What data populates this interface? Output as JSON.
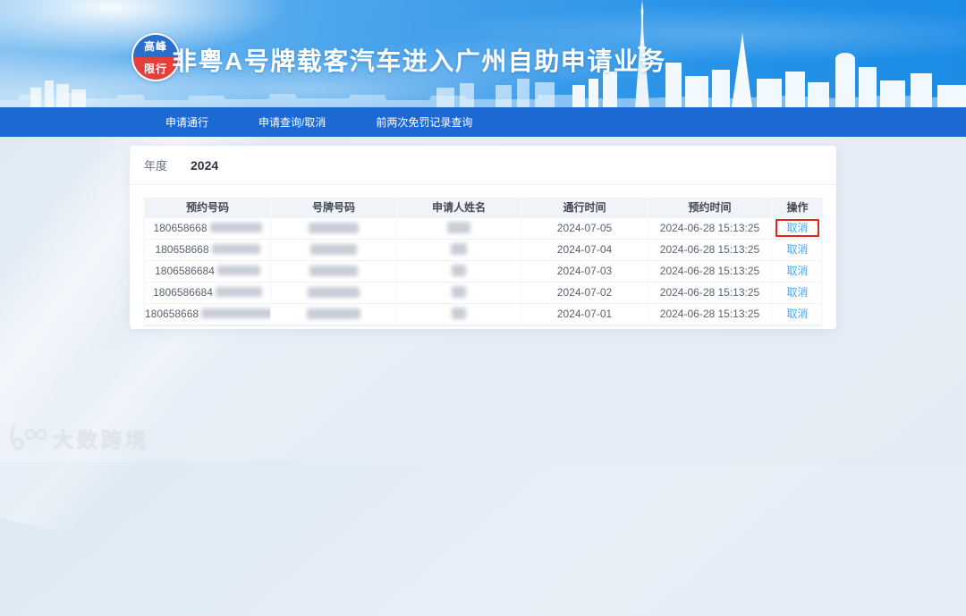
{
  "header": {
    "badge_top": "高峰",
    "badge_bottom": "限行",
    "title": "非粤A号牌载客汽车进入广州自助申请业务"
  },
  "nav": {
    "items": [
      {
        "label": "申请通行"
      },
      {
        "label": "申请查询/取消"
      },
      {
        "label": "前两次免罚记录查询"
      }
    ]
  },
  "filters": {
    "year_label": "年度",
    "year_value": "2024"
  },
  "table": {
    "columns": [
      "预约号码",
      "号牌号码",
      "申请人姓名",
      "通行时间",
      "预约时间",
      "操作"
    ],
    "redacted_columns": [
      "号牌号码",
      "申请人姓名"
    ],
    "rows": [
      {
        "reservation_no_visible": "180658668",
        "pass_date": "2024-07-05",
        "reserved_at": "2024-06-28 15:13:25",
        "action": "取消",
        "action_highlighted": true
      },
      {
        "reservation_no_visible": "180658668",
        "pass_date": "2024-07-04",
        "reserved_at": "2024-06-28 15:13:25",
        "action": "取消",
        "action_highlighted": false
      },
      {
        "reservation_no_visible": "1806586684",
        "pass_date": "2024-07-03",
        "reserved_at": "2024-06-28 15:13:25",
        "action": "取消",
        "action_highlighted": false
      },
      {
        "reservation_no_visible": "1806586684",
        "pass_date": "2024-07-02",
        "reserved_at": "2024-06-28 15:13:25",
        "action": "取消",
        "action_highlighted": false
      },
      {
        "reservation_no_visible": "180658668",
        "pass_date": "2024-07-01",
        "reserved_at": "2024-06-28 15:13:25",
        "action": "取消",
        "action_highlighted": false
      }
    ]
  },
  "watermark": {
    "text": "大数跨境"
  },
  "colors": {
    "nav_blue": "#1c69d3",
    "link_blue": "#4da6e8",
    "highlight_red": "#e2241d",
    "badge_blue": "#2a6fd0",
    "badge_red": "#e4403a"
  }
}
